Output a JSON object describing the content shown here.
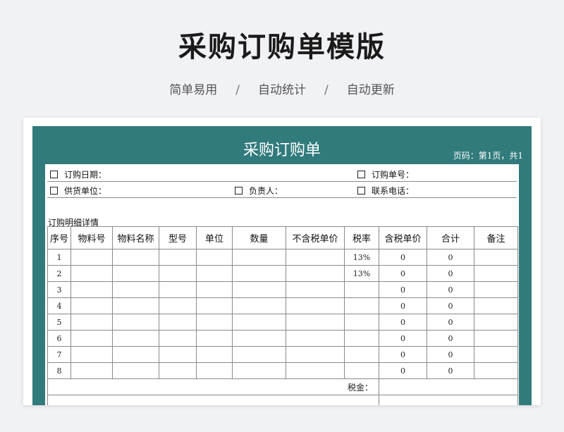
{
  "page": {
    "title": "采购订购单模版",
    "subtitle": [
      "简单易用",
      "自动统计",
      "自动更新"
    ],
    "separator": "/"
  },
  "sheet": {
    "title": "采购订购单",
    "page_code": "页码：第1页，共1",
    "accent_color": "#317b7c",
    "info": {
      "order_date": "订购日期：",
      "order_no": "订购单号：",
      "supplier": "供货单位：",
      "person": "负责人：",
      "phone": "联系电话："
    },
    "detail_label": "订购明细详情",
    "columns": [
      "序号",
      "物料号",
      "物料名称",
      "型号",
      "单位",
      "数量",
      "不含税单价",
      "税率",
      "含税单价",
      "合计",
      "备注"
    ],
    "rows": [
      {
        "no": "1",
        "tax_rate": "13%",
        "price_tax": "0",
        "total": "0"
      },
      {
        "no": "2",
        "tax_rate": "13%",
        "price_tax": "0",
        "total": "0"
      },
      {
        "no": "3",
        "tax_rate": "",
        "price_tax": "0",
        "total": "0"
      },
      {
        "no": "4",
        "tax_rate": "",
        "price_tax": "0",
        "total": "0"
      },
      {
        "no": "5",
        "tax_rate": "",
        "price_tax": "0",
        "total": "0"
      },
      {
        "no": "6",
        "tax_rate": "",
        "price_tax": "0",
        "total": "0"
      },
      {
        "no": "7",
        "tax_rate": "",
        "price_tax": "0",
        "total": "0"
      },
      {
        "no": "8",
        "tax_rate": "",
        "price_tax": "0",
        "total": "0"
      }
    ],
    "tax_label": "税金："
  }
}
